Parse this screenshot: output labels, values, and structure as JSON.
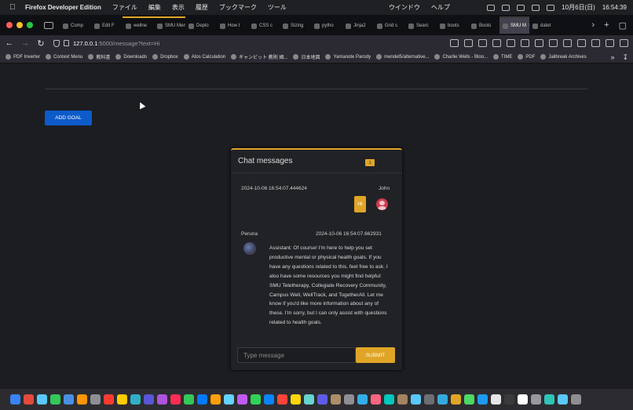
{
  "menubar": {
    "app_name": "Firefox Developer Edition",
    "menus": [
      "ファイル",
      "編集",
      "表示",
      "履歴",
      "ブックマーク",
      "ツール",
      "ウインドウ",
      "ヘルプ"
    ],
    "date": "10月6日(日)",
    "time": "16:54:39"
  },
  "tabs": [
    {
      "label": "Comp"
    },
    {
      "label": "Edit F"
    },
    {
      "label": "wellne"
    },
    {
      "label": "SMU Ment"
    },
    {
      "label": "Deplo"
    },
    {
      "label": "How t"
    },
    {
      "label": "CSS c"
    },
    {
      "label": "Sizing"
    },
    {
      "label": "pytho"
    },
    {
      "label": "Jinja2"
    },
    {
      "label": "Grid s"
    },
    {
      "label": "Searc"
    },
    {
      "label": "boots"
    },
    {
      "label": "Boots"
    },
    {
      "label": "SMU M"
    },
    {
      "label": "datet"
    }
  ],
  "active_tab_index": 14,
  "navbar": {
    "url_host": "127.0.0.1",
    "url_path": ":5000/message?text=Hi"
  },
  "bookmarks": [
    "PDF Inverter",
    "Context Menu",
    "教科書",
    "Downloads",
    "Dropbox",
    "Atos Calculation",
    "ギャンビット 教則 細...",
    "日本地図",
    "Yamanote Parody",
    "mendel5/alternative...",
    "Charlie Wells - Bloo...",
    "TIME",
    "PDF",
    "Jailbreak Archives"
  ],
  "page": {
    "add_goal_label": "ADD GOAL"
  },
  "chat": {
    "title": "Chat messages",
    "unread_count": "1",
    "messages": [
      {
        "sender": "John",
        "timestamp": "2024-10-06 16:54:07.444624",
        "text": "Hi"
      },
      {
        "sender": "Peruna",
        "timestamp": "2024-10-06 16:54:07.662931",
        "text": "Assistant: Of course! I'm here to help you set productive mental or physical health goals. If you have any questions related to this, feel free to ask. I also have some resources you might find helpful: SMU Teletherapy, Collegiate Recovery Community, Campus Well, WellTrack, and TogetherAll. Let me know if you'd like more information about any of these. I'm sorry, but I can only assist with questions related to health goals."
      }
    ],
    "input_placeholder": "Type message",
    "submit_label": "SUBMIT"
  },
  "colors": {
    "accent": "#e0a527",
    "primary_button": "#0d5ac9",
    "background": "#1c1d21"
  }
}
